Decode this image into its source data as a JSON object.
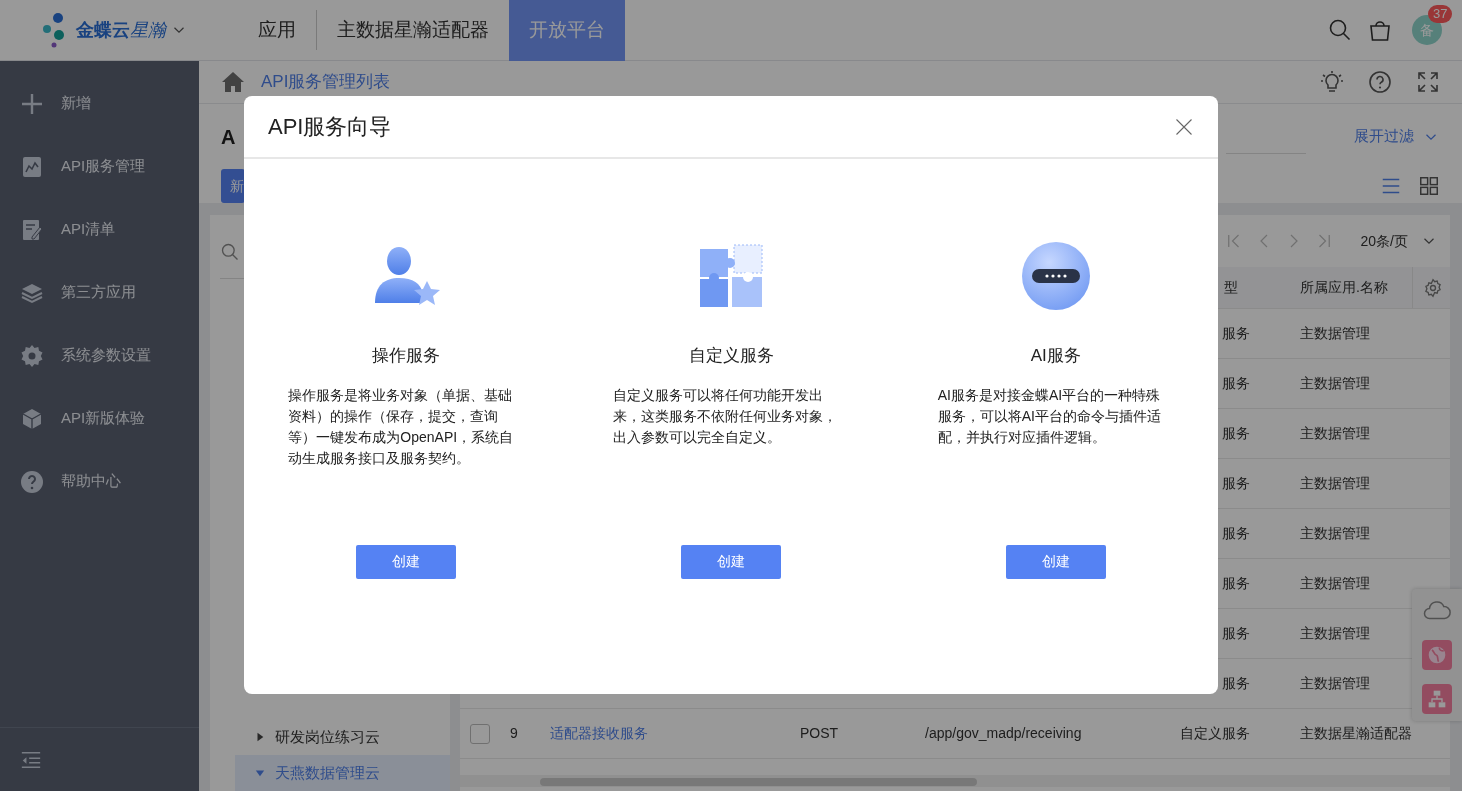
{
  "top_nav": {
    "logo": {
      "name": "金蝶云",
      "suffix": "星瀚"
    },
    "tabs": [
      {
        "label": "应用",
        "selected": false
      },
      {
        "label": "主数据星瀚适配器",
        "selected": false
      },
      {
        "label": "开放平台",
        "selected": true
      }
    ],
    "avatar": "备",
    "badge": "37"
  },
  "sidebar": {
    "items": [
      {
        "kind": "plus",
        "label": "新增"
      },
      {
        "kind": "chart",
        "label": "API服务管理"
      },
      {
        "kind": "edit",
        "label": "API清单"
      },
      {
        "kind": "layers",
        "label": "第三方应用"
      },
      {
        "kind": "gear",
        "label": "系统参数设置"
      },
      {
        "kind": "cube",
        "label": "API新版体验"
      },
      {
        "kind": "help",
        "label": "帮助中心"
      }
    ]
  },
  "breadcrumb": "API服务管理列表",
  "page": {
    "title": "A",
    "new_button": "新",
    "filter_toggle": "展开过滤"
  },
  "tree": {
    "items": [
      {
        "label": "研发岗位练习云",
        "expanded": false,
        "selected": false
      },
      {
        "label": "天燕数据管理云",
        "expanded": true,
        "selected": true
      }
    ]
  },
  "pager": {
    "page_size": "20条/页"
  },
  "table": {
    "columns": [
      "型",
      "所属应用.名称"
    ],
    "rows": [
      {
        "type": "服务",
        "app": "主数据管理"
      },
      {
        "type": "服务",
        "app": "主数据管理"
      },
      {
        "type": "服务",
        "app": "主数据管理"
      },
      {
        "type": "服务",
        "app": "主数据管理"
      },
      {
        "type": "服务",
        "app": "主数据管理"
      },
      {
        "type": "服务",
        "app": "主数据管理"
      },
      {
        "type": "服务",
        "app": "主数据管理"
      },
      {
        "type": "服务",
        "app": "主数据管理"
      },
      {
        "checked": false,
        "number": "9",
        "name": "适配器接收服务",
        "method": "POST",
        "path": "/app/gov_madp/receiving",
        "type": "自定义服务",
        "app": "主数据星瀚适配器"
      }
    ]
  },
  "modal": {
    "title": "API服务向导",
    "services": [
      {
        "kind": "person",
        "title": "操作服务",
        "description": "操作服务是将业务对象（单据、基础资料）的操作（保存，提交，查询等）一键发布成为OpenAPI，系统自动生成服务接口及服务契约。",
        "button": "创建"
      },
      {
        "kind": "puzzle",
        "title": "自定义服务",
        "description": "自定义服务可以将任何功能开发出来，这类服务不依附任何业务对象，出入参数可以完全自定义。",
        "button": "创建"
      },
      {
        "kind": "ai",
        "title": "AI服务",
        "description": "AI服务是对接金蝶AI平台的一种特殊服务，可以将AI平台的命令与插件适配，并执行对应插件逻辑。",
        "button": "创建"
      }
    ]
  }
}
